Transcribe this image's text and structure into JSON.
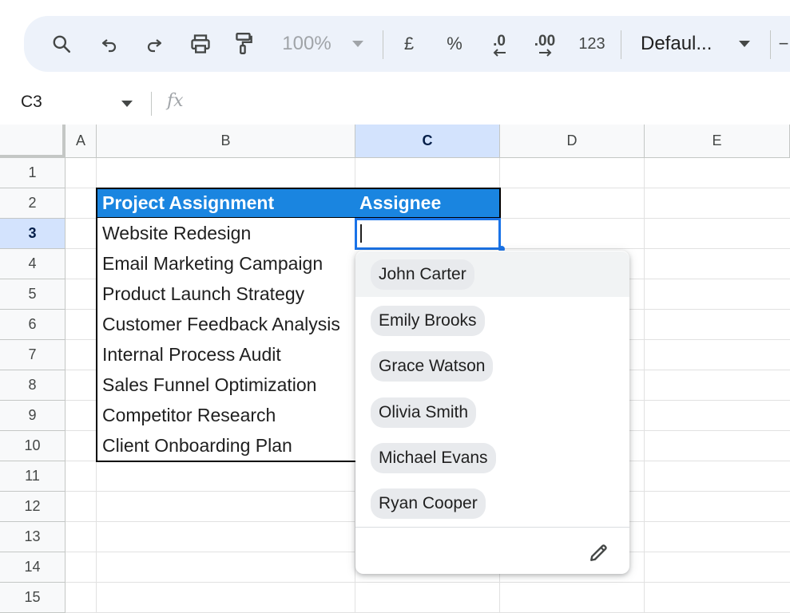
{
  "toolbar": {
    "zoom": "100%",
    "currency": "£",
    "percent": "%",
    "decrease_decimal": ".0",
    "increase_decimal": ".00",
    "number_format": "123",
    "font": "Defaul..."
  },
  "formula_bar": {
    "cell_ref": "C3",
    "fx": "fx"
  },
  "grid": {
    "columns": [
      "A",
      "B",
      "C",
      "D",
      "E"
    ],
    "rows": [
      "1",
      "2",
      "3",
      "4",
      "5",
      "6",
      "7",
      "8",
      "9",
      "10",
      "11",
      "12",
      "13",
      "14",
      "15"
    ],
    "selected_column": "C",
    "selected_row": "3"
  },
  "table": {
    "headers": [
      "Project Assignment",
      "Assignee"
    ],
    "projects": [
      "Website Redesign",
      "Email Marketing Campaign",
      "Product Launch Strategy",
      "Customer Feedback Analysis",
      "Internal Process Audit",
      "Sales Funnel Optimization",
      "Competitor Research",
      "Client Onboarding Plan"
    ]
  },
  "dropdown": {
    "options": [
      "John Carter",
      "Emily Brooks",
      "Grace Watson",
      "Olivia Smith",
      "Michael Evans",
      "Ryan Cooper"
    ],
    "highlighted": "John Carter"
  },
  "colors": {
    "header_fill": "#1a85e0",
    "selection": "#1a73e8",
    "toolbar_bg": "#edf2fa"
  }
}
